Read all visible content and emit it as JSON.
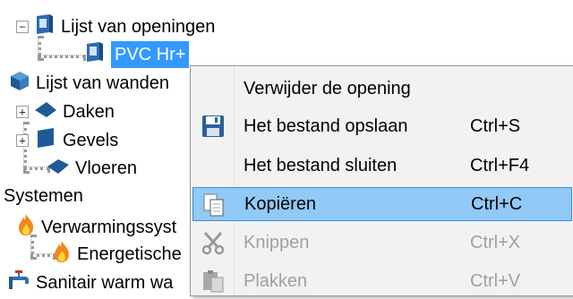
{
  "tree": {
    "openings_list": "Lijst van openingen",
    "selected_child": "PVC Hr+",
    "walls_list": "Lijst van wanden",
    "roofs": "Daken",
    "facades": "Gevels",
    "floors": "Vloeren",
    "systems_header": "Systemen",
    "heating_systems": "Verwarmingssyst",
    "energetic": "Energetische",
    "sanitary": "Sanitair warm wa"
  },
  "context_menu": {
    "items": [
      {
        "label": "Verwijder de opening",
        "shortcut": "",
        "enabled": true,
        "icon": ""
      },
      {
        "label": "Het bestand opslaan",
        "shortcut": "Ctrl+S",
        "enabled": true,
        "icon": "save-icon"
      },
      {
        "label": "Het bestand sluiten",
        "shortcut": "Ctrl+F4",
        "enabled": true,
        "icon": ""
      },
      {
        "label": "Kopiëren",
        "shortcut": "Ctrl+C",
        "enabled": true,
        "icon": "copy-icon",
        "highlighted": true
      },
      {
        "label": "Knippen",
        "shortcut": "Ctrl+X",
        "enabled": false,
        "icon": "scissors-icon"
      },
      {
        "label": "Plakken",
        "shortcut": "Ctrl+V",
        "enabled": false,
        "icon": "paste-icon"
      }
    ]
  },
  "colors": {
    "selection": "#3399ff",
    "menu_highlight": "#91c9f7",
    "menu_background": "#f2f2f2"
  }
}
